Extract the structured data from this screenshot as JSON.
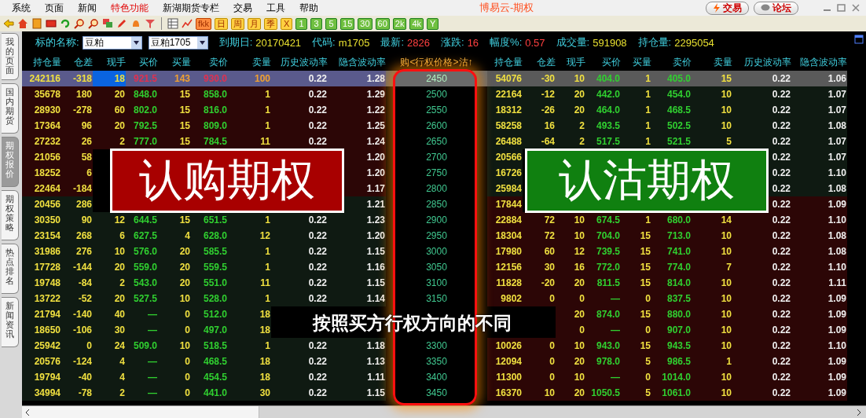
{
  "menu": [
    {
      "label": "系统",
      "highlighted": false
    },
    {
      "label": "页面",
      "highlighted": false
    },
    {
      "label": "新闻",
      "highlighted": false
    },
    {
      "label": "特色功能",
      "highlighted": true
    },
    {
      "label": "新湖期货专栏",
      "highlighted": false
    },
    {
      "label": "交易",
      "highlighted": false
    },
    {
      "label": "工具",
      "highlighted": false
    },
    {
      "label": "帮助",
      "highlighted": false
    }
  ],
  "app_title": "博易云-期权",
  "title_buttons": [
    {
      "kind": "trade",
      "label": "交易"
    },
    {
      "kind": "forum",
      "label": "论坛"
    }
  ],
  "toolbar_text_buttons": [
    {
      "label": "fkk",
      "kind": "red"
    },
    {
      "label": "日",
      "kind": "yellow"
    },
    {
      "label": "周",
      "kind": "yellow"
    },
    {
      "label": "月",
      "kind": "yellow"
    },
    {
      "label": "季",
      "kind": "yellow"
    },
    {
      "label": "X",
      "kind": "yellow"
    },
    {
      "label": "1",
      "kind": "green"
    },
    {
      "label": "3",
      "kind": "green"
    },
    {
      "label": "5",
      "kind": "green"
    },
    {
      "label": "15",
      "kind": "green"
    },
    {
      "label": "30",
      "kind": "green"
    },
    {
      "label": "60",
      "kind": "green"
    },
    {
      "label": "2k",
      "kind": "green"
    },
    {
      "label": "4k",
      "kind": "green"
    },
    {
      "label": "Y",
      "kind": "green"
    }
  ],
  "sidebar": [
    {
      "label": "我的页面",
      "selected": false
    },
    {
      "label": "国内期货",
      "selected": false
    },
    {
      "label": "期权报价",
      "selected": true
    },
    {
      "label": "期权策略",
      "selected": false
    },
    {
      "label": "热点排名",
      "selected": false
    },
    {
      "label": "新闻资讯",
      "selected": false
    }
  ],
  "underlying": {
    "label": "标的名称:",
    "product": "豆粕",
    "contract": "豆粕1705"
  },
  "info": [
    {
      "label": "到期日:",
      "value": "20170421",
      "color": "#e8e030"
    },
    {
      "label": "代码:",
      "value": "m1705",
      "color": "#e8e030"
    },
    {
      "label": "最新:",
      "value": "2826",
      "color": "#ff4040"
    },
    {
      "label": "涨跌:",
      "value": "16",
      "color": "#ff4040"
    },
    {
      "label": "幅度%:",
      "value": "0.57",
      "color": "#ff4040"
    },
    {
      "label": "成交量:",
      "value": "591908",
      "color": "#e8e030"
    },
    {
      "label": "持仓量:",
      "value": "2295054",
      "color": "#e8e030"
    }
  ],
  "call_columns": [
    "持仓量",
    "仓差",
    "现手",
    "买价",
    "买量",
    "卖价",
    "卖量",
    "历史波动率",
    "隐含波动率"
  ],
  "strike_header": "购<行权价格>沽↑",
  "put_columns": [
    "持仓量",
    "仓差",
    "现手",
    "买价",
    "买量",
    "卖价",
    "卖量",
    "历史波动率",
    "隐含波动率"
  ],
  "rows": [
    {
      "selected": true,
      "cursor": true,
      "call": {
        "oi": "242116",
        "chg": "-318",
        "last": "18",
        "bid": "921.5",
        "bid_vol": "143",
        "ask": "930.0",
        "ask_vol": "100",
        "hv": "0.22",
        "iv": "1.28"
      },
      "strike": "2450",
      "put": {
        "oi": "54076",
        "chg": "-30",
        "last": "10",
        "bid": "404.0",
        "bid_vol": "1",
        "ask": "405.0",
        "ask_vol": "15",
        "hv": "0.22",
        "iv": "1.06"
      }
    },
    {
      "selected": false,
      "call_itm": true,
      "put_itm": false,
      "call": {
        "oi": "35678",
        "chg": "180",
        "last": "20",
        "bid": "848.0",
        "bid_vol": "15",
        "ask": "858.0",
        "ask_vol": "1",
        "hv": "0.22",
        "iv": "1.29"
      },
      "strike": "2500",
      "put": {
        "oi": "22164",
        "chg": "-12",
        "last": "20",
        "bid": "442.0",
        "bid_vol": "1",
        "ask": "454.0",
        "ask_vol": "10",
        "hv": "0.22",
        "iv": "1.07"
      }
    },
    {
      "selected": false,
      "call_itm": true,
      "put_itm": false,
      "call": {
        "oi": "28930",
        "chg": "-278",
        "last": "60",
        "bid": "802.0",
        "bid_vol": "15",
        "ask": "816.0",
        "ask_vol": "1",
        "hv": "0.22",
        "iv": "1.22"
      },
      "strike": "2550",
      "put": {
        "oi": "18312",
        "chg": "-26",
        "last": "20",
        "bid": "464.0",
        "bid_vol": "1",
        "ask": "468.5",
        "ask_vol": "10",
        "hv": "0.22",
        "iv": "1.07"
      }
    },
    {
      "selected": false,
      "call_itm": true,
      "put_itm": false,
      "call": {
        "oi": "17364",
        "chg": "96",
        "last": "20",
        "bid": "792.5",
        "bid_vol": "15",
        "ask": "809.0",
        "ask_vol": "1",
        "hv": "0.22",
        "iv": "1.25"
      },
      "strike": "2600",
      "put": {
        "oi": "58258",
        "chg": "16",
        "last": "2",
        "bid": "493.5",
        "bid_vol": "1",
        "ask": "502.5",
        "ask_vol": "10",
        "hv": "0.22",
        "iv": "1.08"
      }
    },
    {
      "selected": false,
      "call_itm": true,
      "put_itm": false,
      "call": {
        "oi": "27232",
        "chg": "26",
        "last": "2",
        "bid": "777.0",
        "bid_vol": "15",
        "ask": "784.5",
        "ask_vol": "11",
        "hv": "0.22",
        "iv": "1.24"
      },
      "strike": "2650",
      "put": {
        "oi": "26488",
        "chg": "-64",
        "last": "2",
        "bid": "517.5",
        "bid_vol": "1",
        "ask": "521.5",
        "ask_vol": "5",
        "hv": "0.22",
        "iv": "1.07"
      }
    },
    {
      "selected": false,
      "call_itm": true,
      "put_itm": false,
      "call": {
        "oi": "21056",
        "chg": "58",
        "iv": "1.20"
      },
      "strike": "2700",
      "put": {
        "oi": "20566",
        "hv": "0.22",
        "iv": "1.07"
      }
    },
    {
      "selected": false,
      "call_itm": true,
      "put_itm": false,
      "call": {
        "oi": "18252",
        "chg": "6",
        "iv": "1.20"
      },
      "strike": "2750",
      "put": {
        "oi": "16726",
        "hv": "0.22",
        "iv": "1.10"
      }
    },
    {
      "selected": false,
      "call_itm": true,
      "put_itm": false,
      "call": {
        "oi": "22464",
        "chg": "-184",
        "iv": "1.17"
      },
      "strike": "2800",
      "put": {
        "oi": "25984",
        "hv": "0.22",
        "iv": "1.08"
      }
    },
    {
      "selected": false,
      "call_itm": false,
      "put_itm": true,
      "call": {
        "oi": "20456",
        "chg": "286",
        "iv": "1.21"
      },
      "strike": "2850",
      "put": {
        "oi": "17844",
        "hv": "0.22",
        "iv": "1.09"
      }
    },
    {
      "selected": false,
      "call_itm": false,
      "put_itm": true,
      "call": {
        "oi": "30350",
        "chg": "90",
        "last": "12",
        "bid": "644.5",
        "bid_vol": "15",
        "ask": "651.5",
        "ask_vol": "1",
        "hv": "0.22",
        "iv": "1.23"
      },
      "strike": "2900",
      "put": {
        "oi": "22884",
        "chg": "72",
        "last": "10",
        "bid": "674.5",
        "bid_vol": "1",
        "ask": "680.0",
        "ask_vol": "14",
        "hv": "0.22",
        "iv": "1.10"
      }
    },
    {
      "selected": false,
      "call_itm": false,
      "put_itm": true,
      "call": {
        "oi": "23154",
        "chg": "268",
        "last": "6",
        "bid": "627.5",
        "bid_vol": "4",
        "ask": "628.0",
        "ask_vol": "12",
        "hv": "0.22",
        "iv": "1.20"
      },
      "strike": "2950",
      "put": {
        "oi": "18304",
        "chg": "72",
        "last": "10",
        "bid": "704.0",
        "bid_vol": "15",
        "ask": "713.0",
        "ask_vol": "10",
        "hv": "0.22",
        "iv": "1.08"
      }
    },
    {
      "selected": false,
      "call_itm": false,
      "put_itm": true,
      "call": {
        "oi": "31986",
        "chg": "276",
        "last": "10",
        "bid": "576.0",
        "bid_vol": "20",
        "ask": "585.5",
        "ask_vol": "1",
        "hv": "0.22",
        "iv": "1.15"
      },
      "strike": "3000",
      "put": {
        "oi": "17980",
        "chg": "60",
        "last": "12",
        "bid": "739.5",
        "bid_vol": "15",
        "ask": "741.0",
        "ask_vol": "10",
        "hv": "0.22",
        "iv": "1.08"
      }
    },
    {
      "selected": false,
      "call_itm": false,
      "put_itm": true,
      "call": {
        "oi": "17728",
        "chg": "-144",
        "last": "20",
        "bid": "559.0",
        "bid_vol": "20",
        "ask": "559.5",
        "ask_vol": "1",
        "hv": "0.22",
        "iv": "1.16"
      },
      "strike": "3050",
      "put": {
        "oi": "12156",
        "chg": "30",
        "last": "16",
        "bid": "772.0",
        "bid_vol": "15",
        "ask": "774.0",
        "ask_vol": "7",
        "hv": "0.22",
        "iv": "1.10"
      }
    },
    {
      "selected": false,
      "call_itm": false,
      "put_itm": true,
      "call": {
        "oi": "19748",
        "chg": "-84",
        "last": "2",
        "bid": "543.0",
        "bid_vol": "20",
        "ask": "551.0",
        "ask_vol": "11",
        "hv": "0.22",
        "iv": "1.15"
      },
      "strike": "3100",
      "put": {
        "oi": "11828",
        "chg": "-20",
        "last": "20",
        "bid": "811.5",
        "bid_vol": "15",
        "ask": "814.0",
        "ask_vol": "10",
        "hv": "0.22",
        "iv": "1.11"
      }
    },
    {
      "selected": false,
      "call_itm": false,
      "put_itm": true,
      "call": {
        "oi": "13722",
        "chg": "-52",
        "last": "20",
        "bid": "527.5",
        "bid_vol": "10",
        "ask": "528.0",
        "ask_vol": "1",
        "hv": "0.22",
        "iv": "1.14"
      },
      "strike": "3150",
      "put": {
        "oi": "9802",
        "chg": "0",
        "last": "0",
        "bid": "—",
        "bid_vol": "0",
        "ask": "837.5",
        "ask_vol": "10",
        "hv": "0.22",
        "iv": "1.09"
      }
    },
    {
      "selected": false,
      "call_itm": false,
      "put_itm": true,
      "call": {
        "oi": "21794",
        "chg": "-140",
        "last": "40",
        "bid": "—",
        "bid_vol": "0",
        "ask": "512.0",
        "ask_vol": "18"
      },
      "put": {
        "last": "20",
        "bid": "874.0",
        "bid_vol": "15",
        "ask": "880.0",
        "ask_vol": "10",
        "hv": "0.22",
        "iv": "1.09"
      }
    },
    {
      "selected": false,
      "call_itm": false,
      "put_itm": true,
      "call": {
        "oi": "18650",
        "chg": "-106",
        "last": "30",
        "bid": "—",
        "bid_vol": "0",
        "ask": "497.0",
        "ask_vol": "18"
      },
      "put": {
        "last": "0",
        "bid": "—",
        "bid_vol": "0",
        "ask": "907.0",
        "ask_vol": "10",
        "hv": "0.22",
        "iv": "1.09"
      }
    },
    {
      "selected": false,
      "call_itm": false,
      "put_itm": true,
      "call": {
        "oi": "25942",
        "chg": "0",
        "last": "24",
        "bid": "509.0",
        "bid_vol": "10",
        "ask": "518.5",
        "ask_vol": "1",
        "hv": "0.22",
        "iv": "1.18"
      },
      "strike": "3300",
      "put": {
        "oi": "10026",
        "chg": "0",
        "last": "10",
        "bid": "943.0",
        "bid_vol": "15",
        "ask": "943.5",
        "ask_vol": "10",
        "hv": "0.22",
        "iv": "1.10"
      }
    },
    {
      "selected": false,
      "call_itm": false,
      "put_itm": true,
      "call": {
        "oi": "20576",
        "chg": "-124",
        "last": "4",
        "bid": "—",
        "bid_vol": "0",
        "ask": "468.5",
        "ask_vol": "18",
        "hv": "0.22",
        "iv": "1.13"
      },
      "strike": "3350",
      "put": {
        "oi": "12094",
        "chg": "0",
        "last": "20",
        "bid": "978.0",
        "bid_vol": "5",
        "ask": "986.5",
        "ask_vol": "1",
        "hv": "0.22",
        "iv": "1.09"
      }
    },
    {
      "selected": false,
      "call_itm": false,
      "put_itm": true,
      "call": {
        "oi": "19794",
        "chg": "-40",
        "last": "4",
        "bid": "—",
        "bid_vol": "0",
        "ask": "454.5",
        "ask_vol": "18",
        "hv": "0.22",
        "iv": "1.11"
      },
      "strike": "3400",
      "put": {
        "oi": "11300",
        "chg": "0",
        "last": "10",
        "bid": "—",
        "bid_vol": "0",
        "ask": "1014.0",
        "ask_vol": "10",
        "hv": "0.22",
        "iv": "1.09"
      }
    },
    {
      "selected": false,
      "call_itm": false,
      "put_itm": true,
      "call": {
        "oi": "34994",
        "chg": "-78",
        "last": "2",
        "bid": "—",
        "bid_vol": "0",
        "ask": "441.0",
        "ask_vol": "30",
        "hv": "0.22",
        "iv": "1.15"
      },
      "strike": "3450",
      "put": {
        "oi": "16370",
        "chg": "10",
        "last": "20",
        "bid": "1050.5",
        "bid_vol": "5",
        "ask": "1061.0",
        "ask_vol": "10",
        "hv": "0.22",
        "iv": "1.09"
      }
    }
  ],
  "overlays": {
    "call_label": "认购期权",
    "put_label": "认沽期权",
    "caption": "按照买方行权方向的不同"
  }
}
